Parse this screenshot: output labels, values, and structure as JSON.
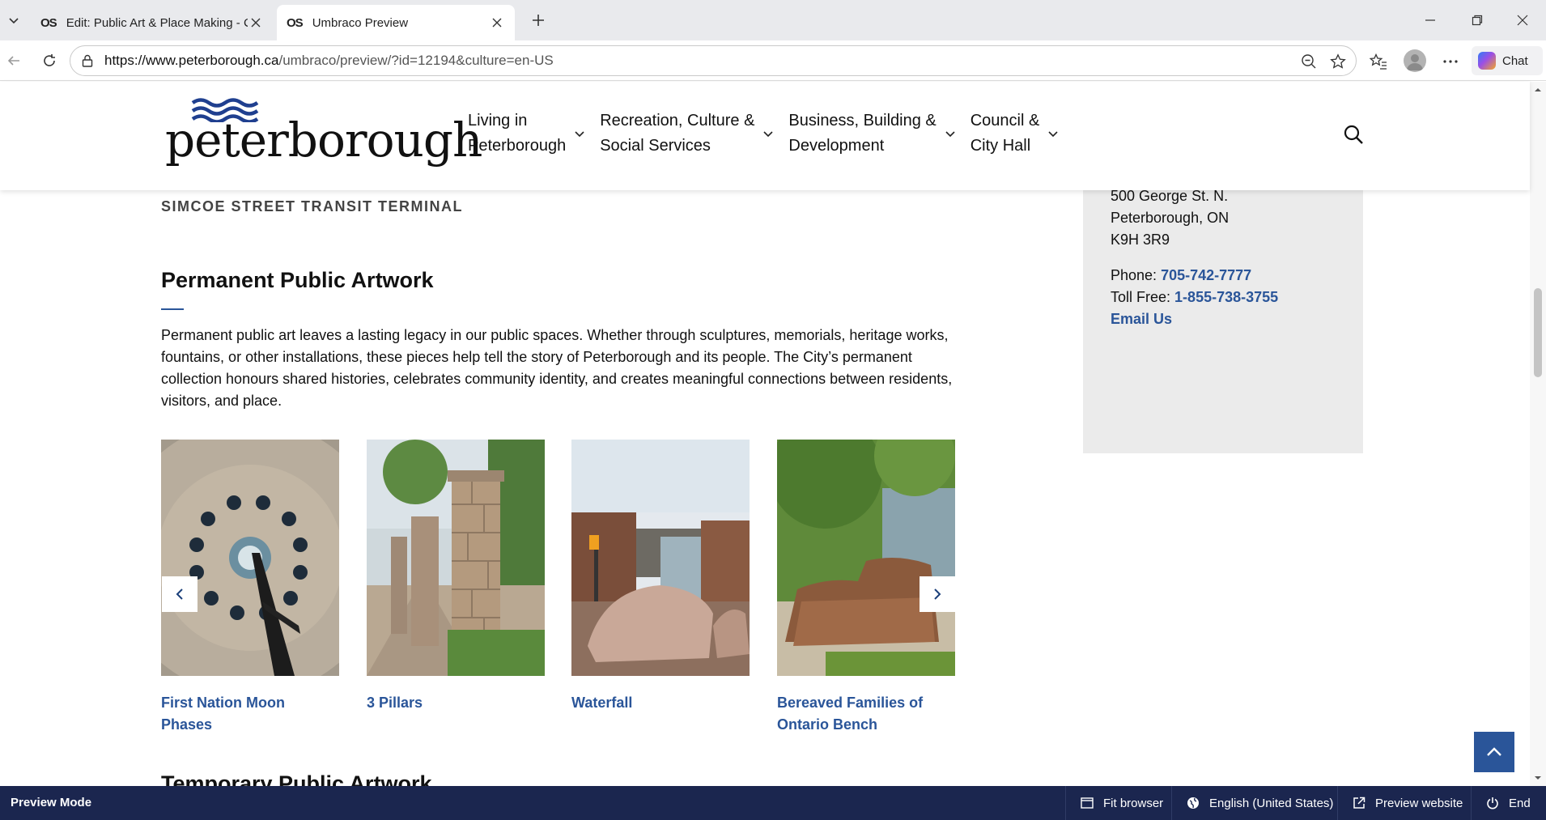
{
  "browser": {
    "tabs": [
      {
        "label": "Edit: Public Art & Place Making - C",
        "favicon": "OS",
        "active": false
      },
      {
        "label": "Umbraco Preview",
        "favicon": "OS",
        "active": true
      }
    ],
    "url_host": "https://www.peterborough.ca",
    "url_path": "/umbraco/preview/?id=12194&culture=en-US",
    "chat_label": "Chat"
  },
  "site": {
    "logo_text": "peterborough",
    "nav": [
      {
        "label": "Living in\nPeterborough"
      },
      {
        "label": "Recreation, Culture &\nSocial Services"
      },
      {
        "label": "Business, Building &\nDevelopment"
      },
      {
        "label": "Council &\nCity Hall"
      }
    ]
  },
  "main": {
    "section_label": "SIMCOE STREET TRANSIT TERMINAL",
    "heading": "Permanent Public Artwork",
    "intro": "Permanent public art leaves a lasting legacy in our public spaces. Whether through sculptures, memorials, heritage works, fountains, or other installations, these pieces help tell the story of Peterborough and its people. The City’s permanent collection honours shared histories, celebrates community identity, and creates meaningful connections between residents, visitors, and place.",
    "cards": [
      {
        "caption": "First Nation Moon Phases"
      },
      {
        "caption": "3 Pillars"
      },
      {
        "caption": "Waterfall"
      },
      {
        "caption": "Bereaved Families of Ontario Bench"
      }
    ],
    "next_heading": "Temporary Public Artwork"
  },
  "contact": {
    "address1": "500 George St. N.",
    "address2": "Peterborough, ON",
    "postal": "K9H 3R9",
    "phone_label": "Phone:",
    "phone": "705-742-7777",
    "tollfree_label": "Toll Free:",
    "tollfree": "1-855-738-3755",
    "email": "Email Us"
  },
  "previewbar": {
    "mode": "Preview Mode",
    "fit": "Fit browser",
    "language": "English (United States)",
    "preview_site": "Preview website",
    "end": "End"
  },
  "colors": {
    "brand_blue": "#2a5599",
    "preview_bar": "#1b264f"
  }
}
